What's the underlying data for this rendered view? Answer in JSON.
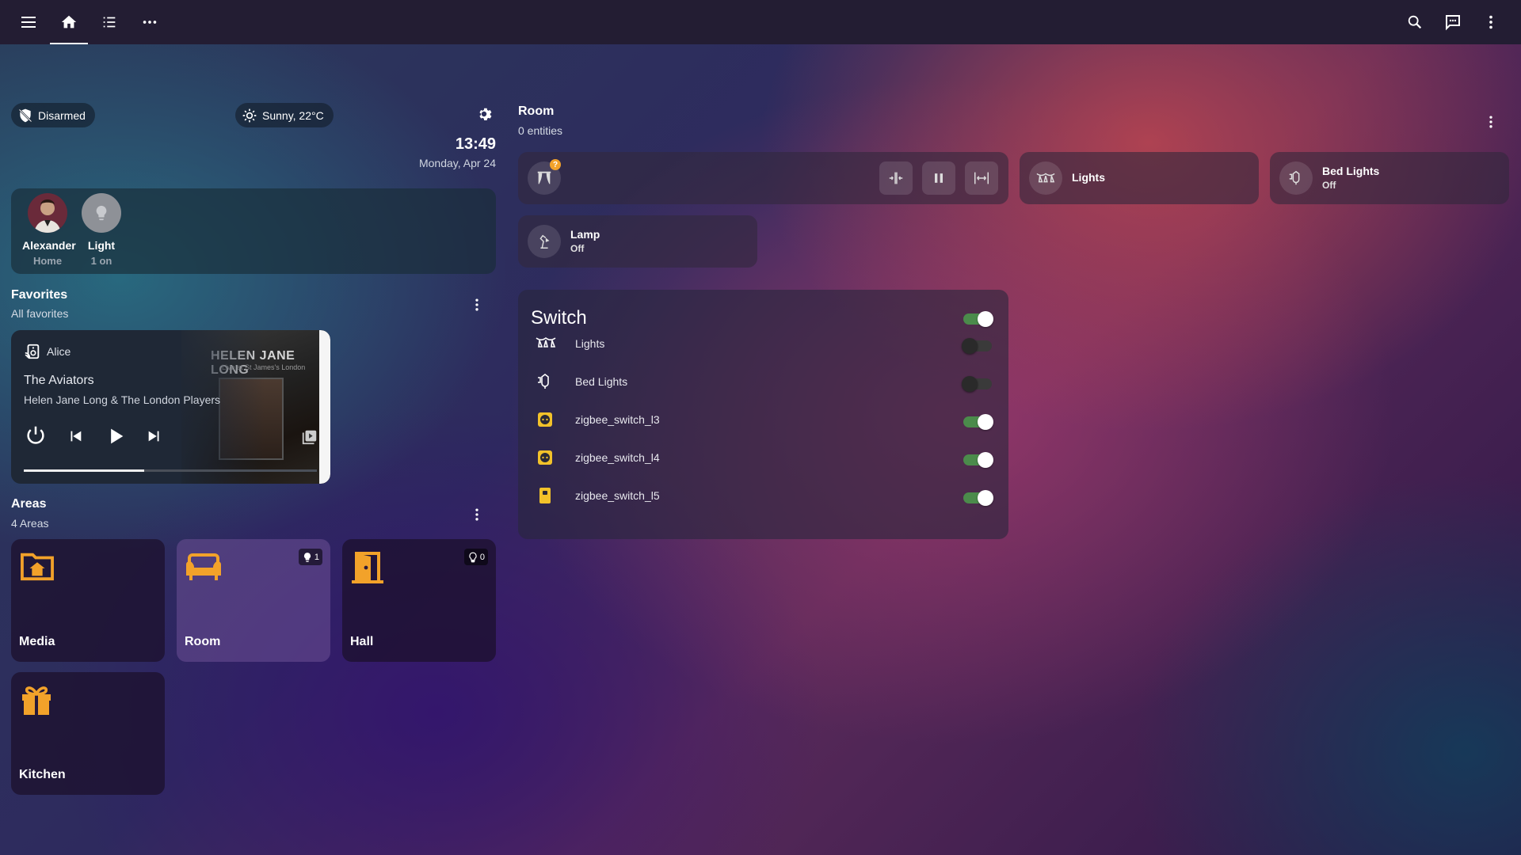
{
  "topbar": {
    "icons": [
      "menu-icon",
      "home-icon",
      "list-icon",
      "more-horizontal-icon",
      "search-icon",
      "assist-chat-icon",
      "more-vertical-icon"
    ]
  },
  "status": {
    "alarm": "Disarmed",
    "weather": "Sunny, 22°C",
    "time": "13:49",
    "date": "Monday, Apr 24"
  },
  "persons": [
    {
      "name": "Alexander",
      "state": "Home"
    },
    {
      "name": "Light",
      "state": "1 on"
    }
  ],
  "favorites": {
    "title": "Favorites",
    "subtitle": "All favorites",
    "media": {
      "player": "Alice",
      "title": "The Aviators",
      "artist": "Helen Jane Long & The London Players",
      "album_art_title": "HELEN JANE LONG",
      "album_art_subtitle": "Live at St James's London",
      "progress": 0.41
    }
  },
  "areas": {
    "title": "Areas",
    "subtitle": "4 Areas",
    "items": [
      {
        "name": "Media",
        "icon": "home-folder-icon"
      },
      {
        "name": "Room",
        "icon": "sofa-icon",
        "badge": "1"
      },
      {
        "name": "Hall",
        "icon": "door-icon",
        "badge": "0"
      },
      {
        "name": "Kitchen",
        "icon": "gift-icon"
      }
    ]
  },
  "room": {
    "title": "Room",
    "subtitle": "0 entities",
    "cover_badge": "?",
    "tiles": [
      {
        "name": "Lights",
        "state": ""
      },
      {
        "name": "Bed Lights",
        "state": "Off"
      },
      {
        "name": "Lamp",
        "state": "Off"
      }
    ]
  },
  "switch_card": {
    "title": "Switch",
    "master_on": true,
    "rows": [
      {
        "label": "Lights",
        "on": false
      },
      {
        "label": "Bed Lights",
        "on": false
      },
      {
        "label": "zigbee_switch_l3",
        "on": true
      },
      {
        "label": "zigbee_switch_l4",
        "on": true
      },
      {
        "label": "zigbee_switch_l5",
        "on": true
      }
    ]
  },
  "colors": {
    "accent": "#f2a22a",
    "toggle_on": "#4b8b4b",
    "topbar": "#231d33"
  }
}
